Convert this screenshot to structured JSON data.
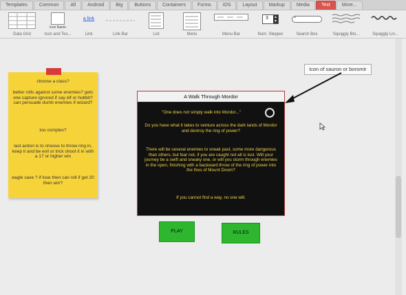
{
  "tabs": [
    "Templates",
    "Common",
    "All",
    "Android",
    "Big",
    "Buttons",
    "Containers",
    "Forms",
    "iOS",
    "Layout",
    "Markup",
    "Media",
    "Text",
    "More..."
  ],
  "active_tab": "Text",
  "toolbar": {
    "items": [
      {
        "label": "Data Grid"
      },
      {
        "label": "Icon and Tex...",
        "thumb_text": "Icon Name"
      },
      {
        "label": "Link",
        "thumb_text": "a link"
      },
      {
        "label": "Link Bar"
      },
      {
        "label": "List"
      },
      {
        "label": "Menu"
      },
      {
        "label": "Menu Bar"
      },
      {
        "label": "Num. Stepper",
        "thumb_text": "3"
      },
      {
        "label": "Search Box"
      },
      {
        "label": "Squiggly Blo..."
      },
      {
        "label": "Squiggly Lin..."
      }
    ]
  },
  "sticky": {
    "lines": [
      "choose a class?",
      "better rolls against some enemies? gets one capture ignored if say elf or hobbit? can persuade dumb enemies if wizard?",
      "too complex?",
      "last action is to choose to throw ring in, keep it and be evil or trick shoot it in with a 17 or higher win",
      "eagle save ? if lose then can roll if get 20 then win?"
    ]
  },
  "dialog": {
    "title": "A Walk Through Mordor",
    "quote": "\"One does not simply walk into Mordor...\"",
    "p1": "Do you have what it takes to venture across the dark lands of Mordor and destroy the ring of power?",
    "p2": "There will be several enemies to sneak past, some more dangerous than others, but fear not, if you are caught not all is lost. Will your journey be a swift and sneaky one, or will you storm through enemies in the open, finishing with a backward throw of the ring of power into the fires of Mount Doom?",
    "p3": "If you cannot find a way, no one will."
  },
  "buttons": {
    "play": "PLAY",
    "rules": "RULES"
  },
  "annotation": "icon of sauron or boromir",
  "colors": {
    "accent": "#d9534f",
    "note": "#f7d33a",
    "dialog_text": "#f0d34a",
    "button": "#2eb62e"
  }
}
